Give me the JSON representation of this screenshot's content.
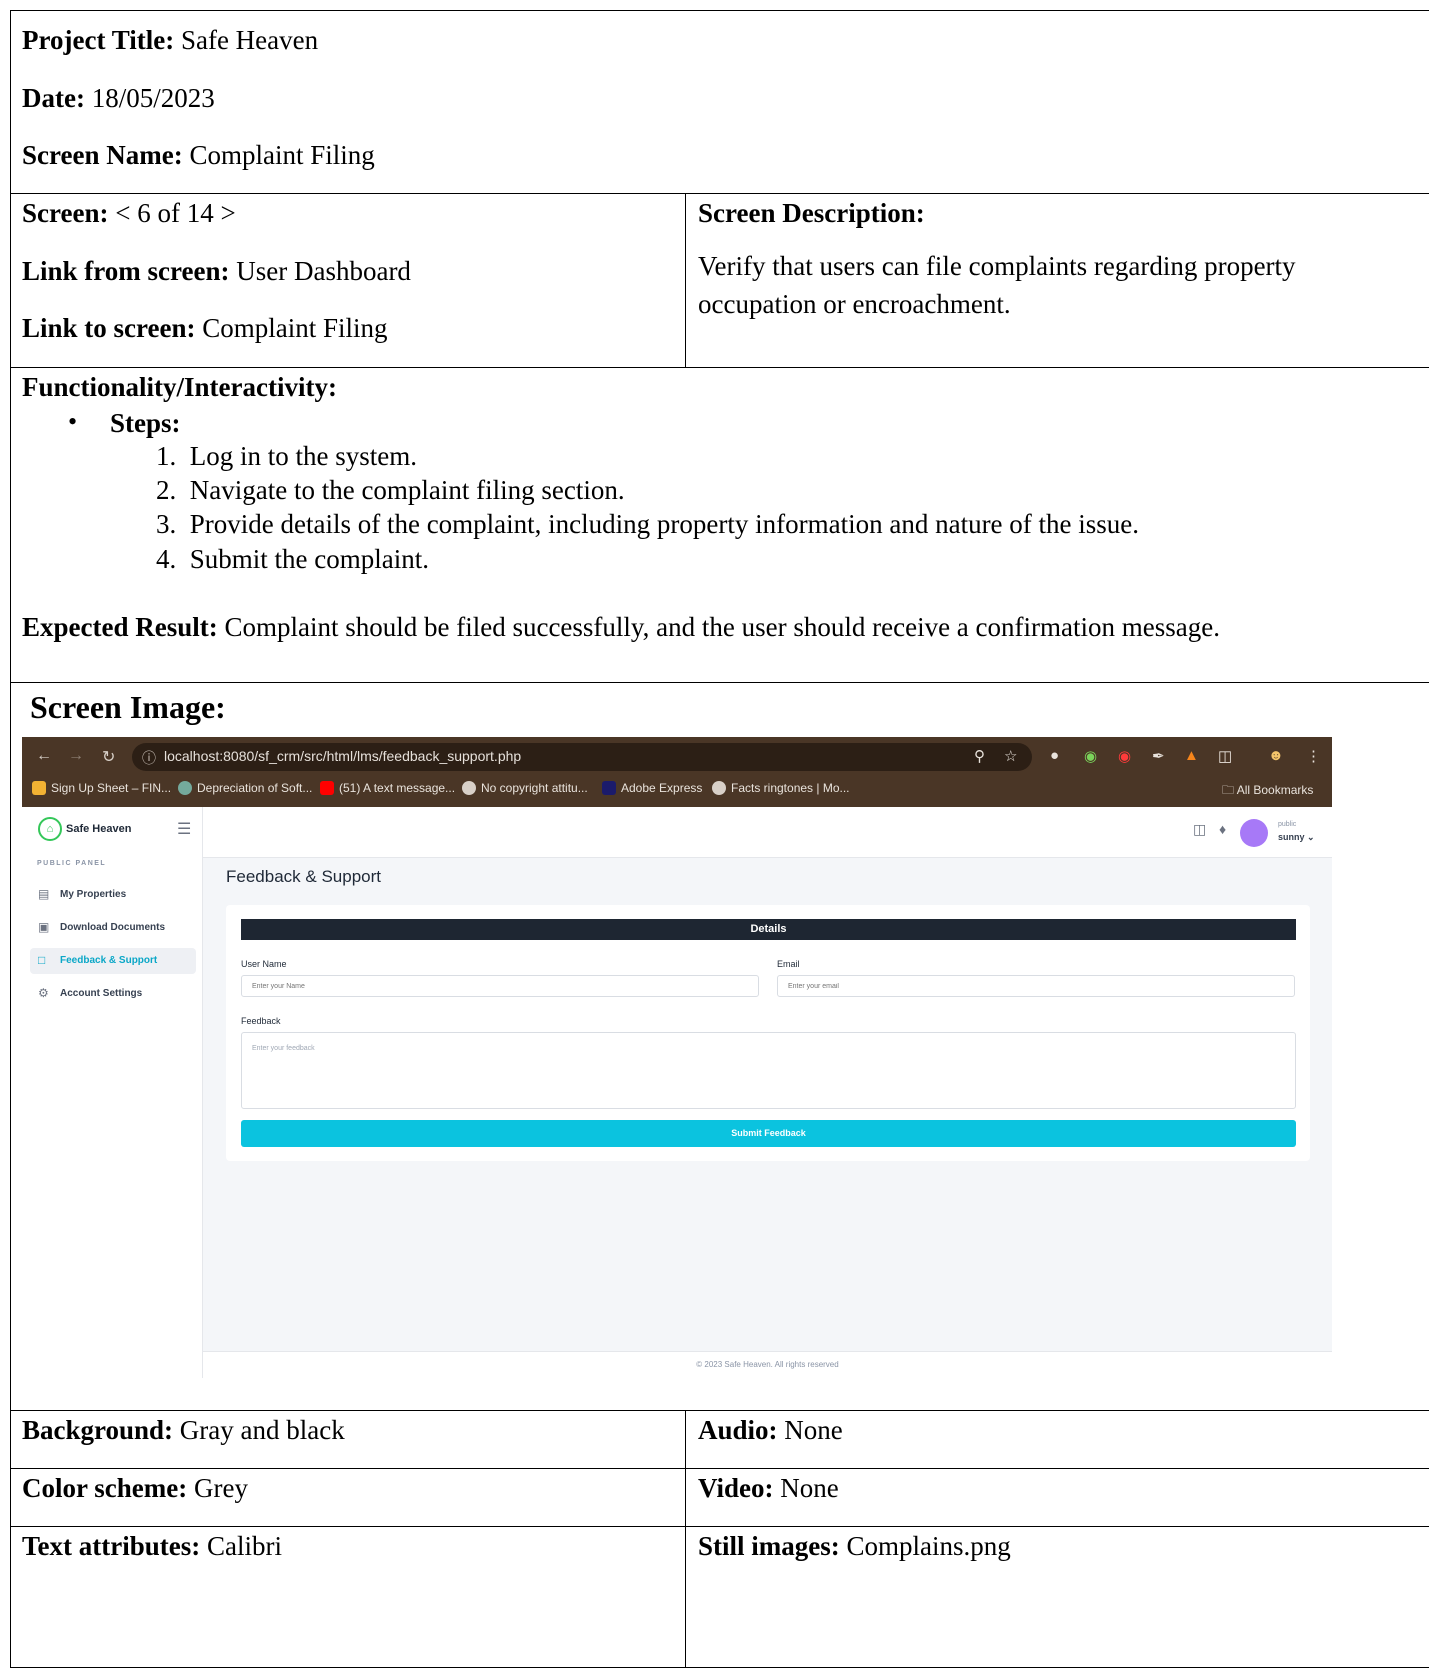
{
  "header": {
    "project_title_label": "Project Title:",
    "project_title_value": "Safe Heaven",
    "date_label": "Date:",
    "date_value": "18/05/2023",
    "screen_name_label": "Screen Name:",
    "screen_name_value": "Complaint Filing"
  },
  "screen_info": {
    "screen_label": "Screen:",
    "screen_value": "< 6 of 14 >",
    "link_from_label": "Link from screen:",
    "link_from_value": "User Dashboard",
    "link_to_label": "Link to screen:",
    "link_to_value": "Complaint Filing",
    "description_label": "Screen Description:",
    "description_value": "Verify that users can file complaints regarding property occupation or encroachment."
  },
  "functionality": {
    "heading": "Functionality/Interactivity:",
    "steps_label": "Steps:",
    "steps": [
      "Log in to the system.",
      "Navigate to the complaint filing section.",
      "Provide details of the complaint, including property information and nature of the issue.",
      "Submit the complaint."
    ],
    "expected_label": "Expected Result:",
    "expected_value": "Complaint should be filed successfully, and the user should receive a confirmation message."
  },
  "screen_image": {
    "heading": "Screen Image:",
    "browser": {
      "url": "localhost:8080/sf_crm/src/html/lms/feedback_support.php",
      "bookmarks": [
        "Sign Up Sheet – FIN...",
        "Depreciation of Soft...",
        "(51) A text message...",
        "No copyright attitu...",
        "Adobe Express",
        "Facts ringtones | Mo..."
      ],
      "all_bookmarks": "All Bookmarks"
    },
    "app": {
      "logo_text": "Safe Heaven",
      "panel_label": "PUBLIC PANEL",
      "nav": [
        "My Properties",
        "Download Documents",
        "Feedback & Support",
        "Account Settings"
      ],
      "user_role": "public",
      "user_name": "sunny",
      "page_title": "Feedback & Support",
      "details_heading": "Details",
      "user_name_label": "User Name",
      "user_name_placeholder": "Enter your Name",
      "email_label": "Email",
      "email_placeholder": "Enter your email",
      "feedback_label": "Feedback",
      "feedback_placeholder": "Enter your feedback",
      "submit_label": "Submit Feedback",
      "footer": "© 2023 Safe Heaven. All rights reserved"
    }
  },
  "attributes": {
    "background_label": "Background:",
    "background_value": "Gray and black",
    "audio_label": "Audio:",
    "audio_value": "None",
    "color_label": "Color scheme:",
    "color_value": "Grey",
    "video_label": "Video:",
    "video_value": "None",
    "text_label": "Text attributes:",
    "text_value": "Calibri",
    "still_label": "Still images:",
    "still_value": "Complains.png"
  }
}
